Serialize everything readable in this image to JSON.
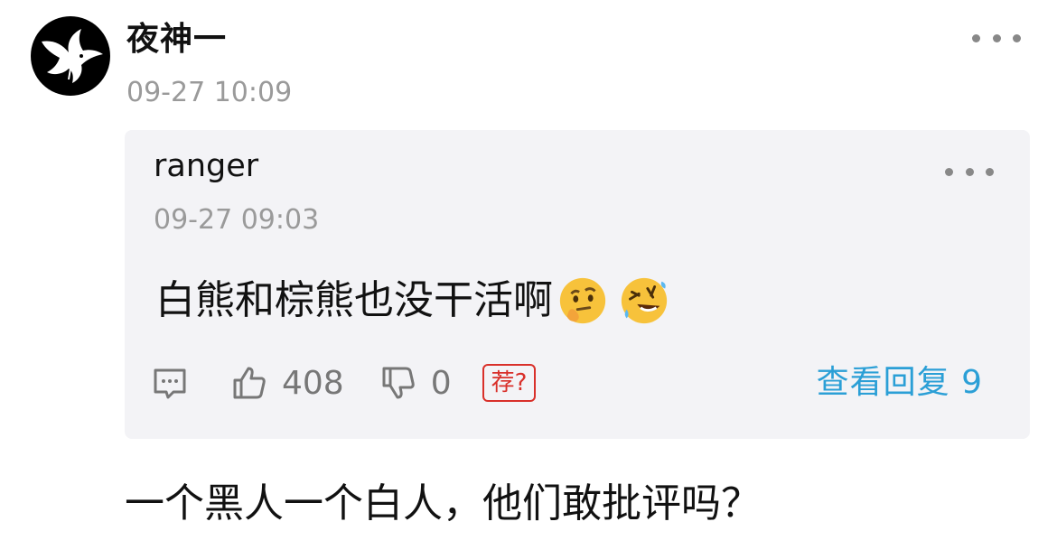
{
  "comment": {
    "username": "夜神一",
    "timestamp": "09-27 10:09",
    "text": "一个黑人一个白人，他们敢批评吗？",
    "more_icon": "more-horizontal-icon",
    "avatar_icon": "white-dove-icon"
  },
  "quoted": {
    "username": "ranger",
    "timestamp": "09-27 09:03",
    "text": "白熊和棕熊也没干活啊",
    "emojis": [
      "thinking-face-emoji",
      "rolling-on-the-floor-laughing-emoji"
    ],
    "likes": "408",
    "dislikes": "0",
    "recommend_badge": "荐?",
    "view_replies": "查看回复 9",
    "icons": [
      "comment-icon",
      "thumbs-up-icon",
      "thumbs-down-icon"
    ]
  },
  "colors": {
    "link": "#2b9fd6",
    "badge": "#d9302a",
    "quote_bg": "#f3f3f6",
    "meta_gray": "#9a9a9a"
  }
}
